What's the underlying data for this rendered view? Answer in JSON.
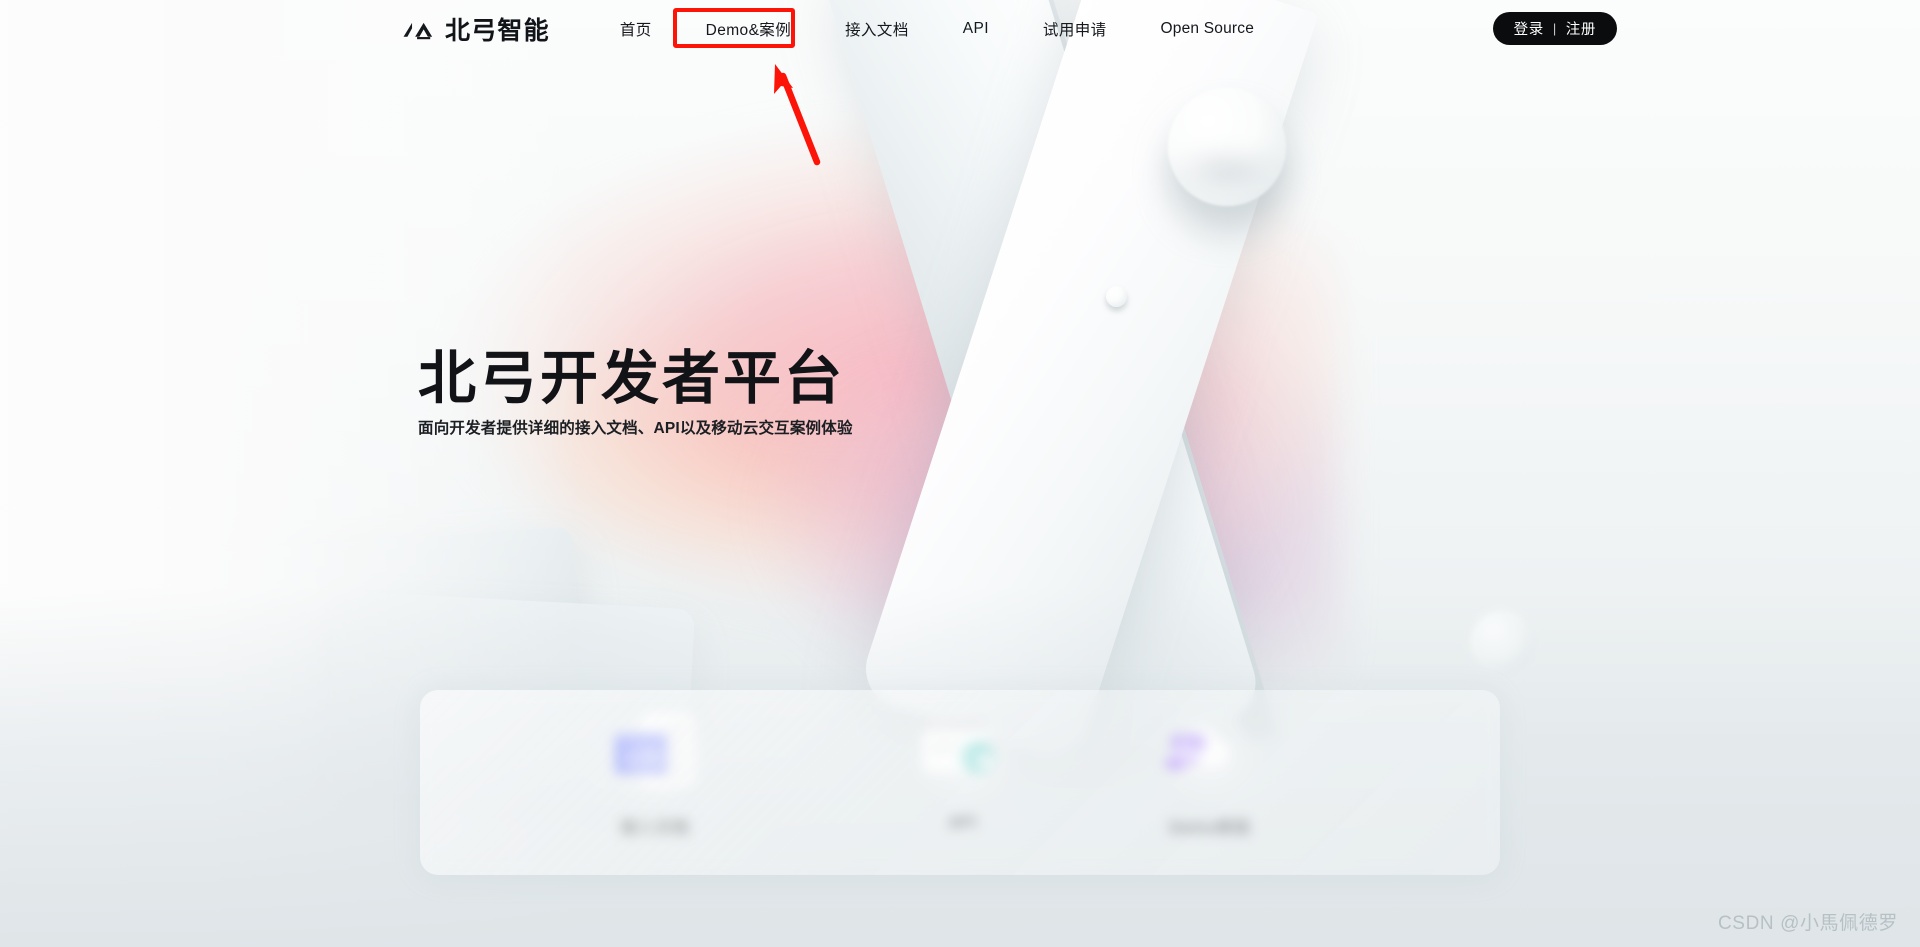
{
  "brand": {
    "name": "北弓智能",
    "logo_icon": "beigong-mountain-logo-icon"
  },
  "nav": {
    "items": [
      {
        "label": "首页",
        "id": "home"
      },
      {
        "label": "Demo&案例",
        "id": "demo-cases"
      },
      {
        "label": "接入文档",
        "id": "integration-docs"
      },
      {
        "label": "API",
        "id": "api"
      },
      {
        "label": "试用申请",
        "id": "trial-application"
      },
      {
        "label": "Open Source",
        "id": "open-source"
      }
    ],
    "auth": {
      "login_label": "登录",
      "separator": "|",
      "register_label": "注册"
    }
  },
  "hero": {
    "title": "北弓开发者平台",
    "subtitle": "面向开发者提供详细的接入文档、API以及移动云交互案例体验"
  },
  "features": [
    {
      "label": "接入文档",
      "icon": "code-document-icon"
    },
    {
      "label": "API",
      "icon": "api-gear-browser-icon"
    },
    {
      "label": "Demo体验",
      "icon": "cloud-hand-server-icon"
    }
  ],
  "annotation": {
    "highlight_target": "Demo&案例",
    "color": "#fb1407",
    "arrow": "red-pointer-arrow"
  },
  "watermark": {
    "text": "CSDN @小馬佩德罗"
  },
  "colors": {
    "accent_red": "#fb1407",
    "auth_button_bg": "#0b0c0e",
    "text_primary": "#111317",
    "code_icon_blue": "#4a5cf5",
    "api_icon_teal": "#2fc0b8",
    "demo_icon_purple": "#8b5cf6"
  }
}
